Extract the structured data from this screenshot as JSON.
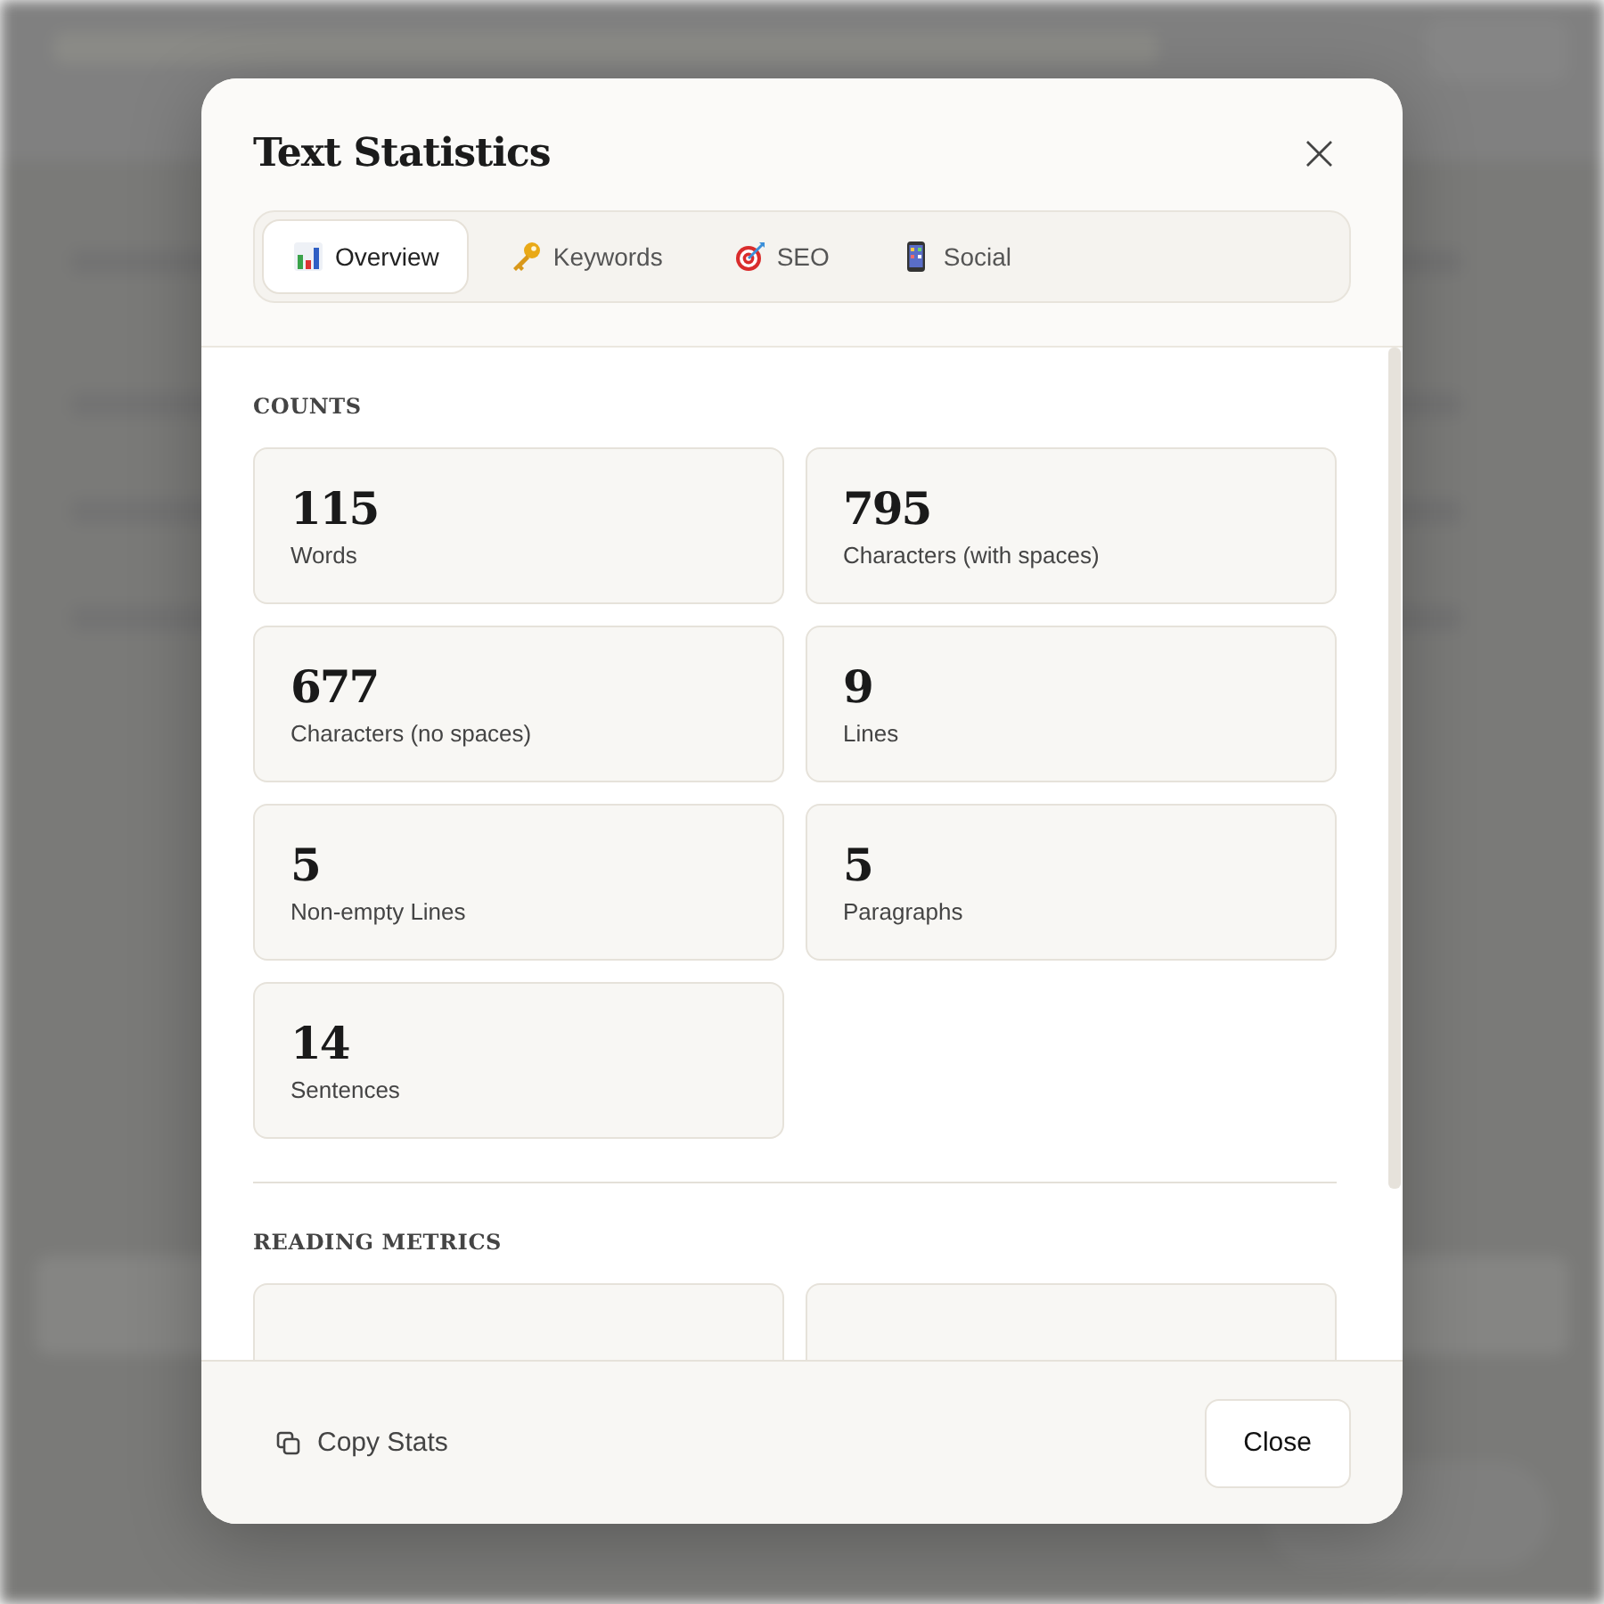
{
  "dialog": {
    "title": "Text Statistics",
    "close_icon": "×"
  },
  "tabs": [
    {
      "label": "Overview",
      "kind": "chart",
      "selected": true
    },
    {
      "label": "Keywords",
      "kind": "key",
      "selected": false
    },
    {
      "label": "SEO",
      "kind": "target",
      "selected": false
    },
    {
      "label": "Social",
      "kind": "phone",
      "selected": false
    }
  ],
  "sections": [
    {
      "title": "COUNTS",
      "cards": [
        {
          "kind": "stat",
          "value": "115",
          "label": "Words"
        },
        {
          "kind": "stat",
          "value": "795",
          "label": "Characters (with spaces)"
        },
        {
          "kind": "stat",
          "value": "677",
          "label": "Characters (no spaces)"
        },
        {
          "kind": "stat",
          "value": "9",
          "label": "Lines"
        },
        {
          "kind": "stat",
          "value": "5",
          "label": "Non-empty Lines"
        },
        {
          "kind": "stat",
          "value": "5",
          "label": "Paragraphs"
        },
        {
          "kind": "stat",
          "value": "14",
          "label": "Sentences"
        }
      ]
    },
    {
      "title": "READING METRICS",
      "cards": [
        {
          "kind": "cut"
        },
        {
          "kind": "cut"
        }
      ]
    }
  ],
  "footer": {
    "copy_button": "Copy Stats",
    "close_button": "Close"
  }
}
